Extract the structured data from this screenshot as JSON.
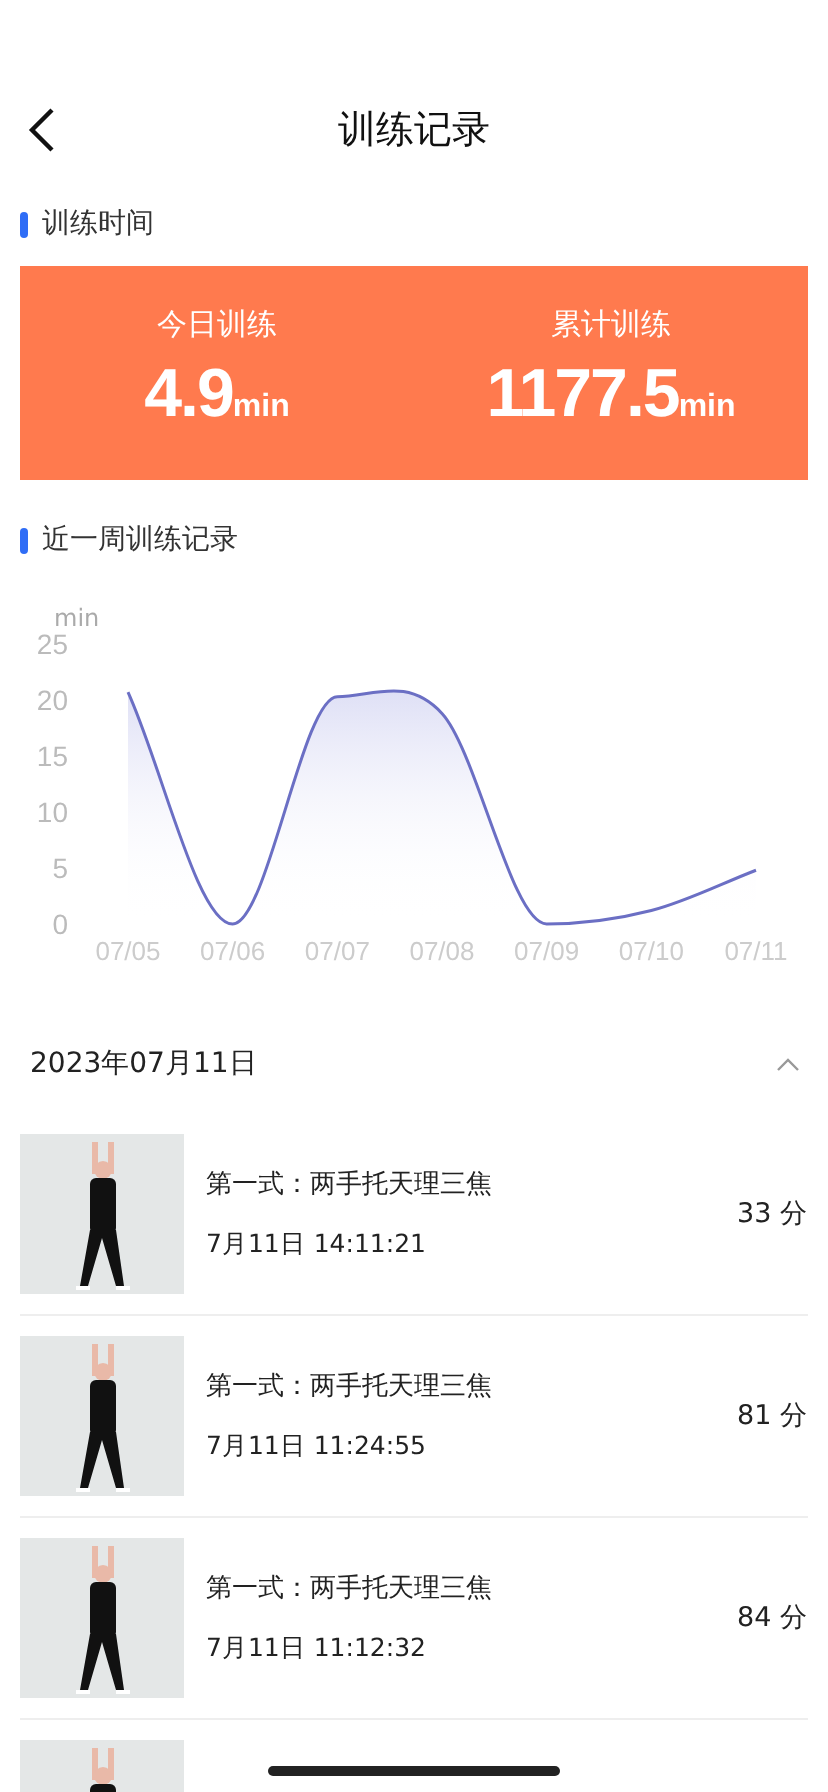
{
  "header": {
    "title": "训练记录"
  },
  "summary": {
    "section_title": "训练时间",
    "stats": [
      {
        "label": "今日训练",
        "value": "4.9",
        "unit": "min"
      },
      {
        "label": "累计训练",
        "value": "1177.5",
        "unit": "min"
      }
    ]
  },
  "weekly": {
    "section_title": "近一周训练记录",
    "chart_data": {
      "type": "area",
      "ylabel": "min",
      "categories": [
        "07/05",
        "07/06",
        "07/07",
        "07/08",
        "07/09",
        "07/10",
        "07/11"
      ],
      "series": [
        {
          "color": "#6b6fc4",
          "values": [
            20.7,
            0,
            20.3,
            18.8,
            0,
            1.2,
            4.8
          ]
        }
      ],
      "ylim": [
        0,
        25
      ],
      "yticks": [
        0,
        5,
        10,
        15,
        20,
        25
      ]
    }
  },
  "day": {
    "date": "2023年07月11日",
    "expanded": true
  },
  "records": [
    {
      "kind": "record",
      "title": "第一式：两手托天理三焦",
      "time": "7月11日 14:11:21",
      "score": "33 分"
    },
    {
      "kind": "record",
      "title": "第一式：两手托天理三焦",
      "time": "7月11日 11:24:55",
      "score": "81 分"
    },
    {
      "kind": "record",
      "title": "第一式：两手托天理三焦",
      "time": "7月11日 11:12:32",
      "score": "84 分"
    },
    {
      "kind": "picture"
    }
  ]
}
